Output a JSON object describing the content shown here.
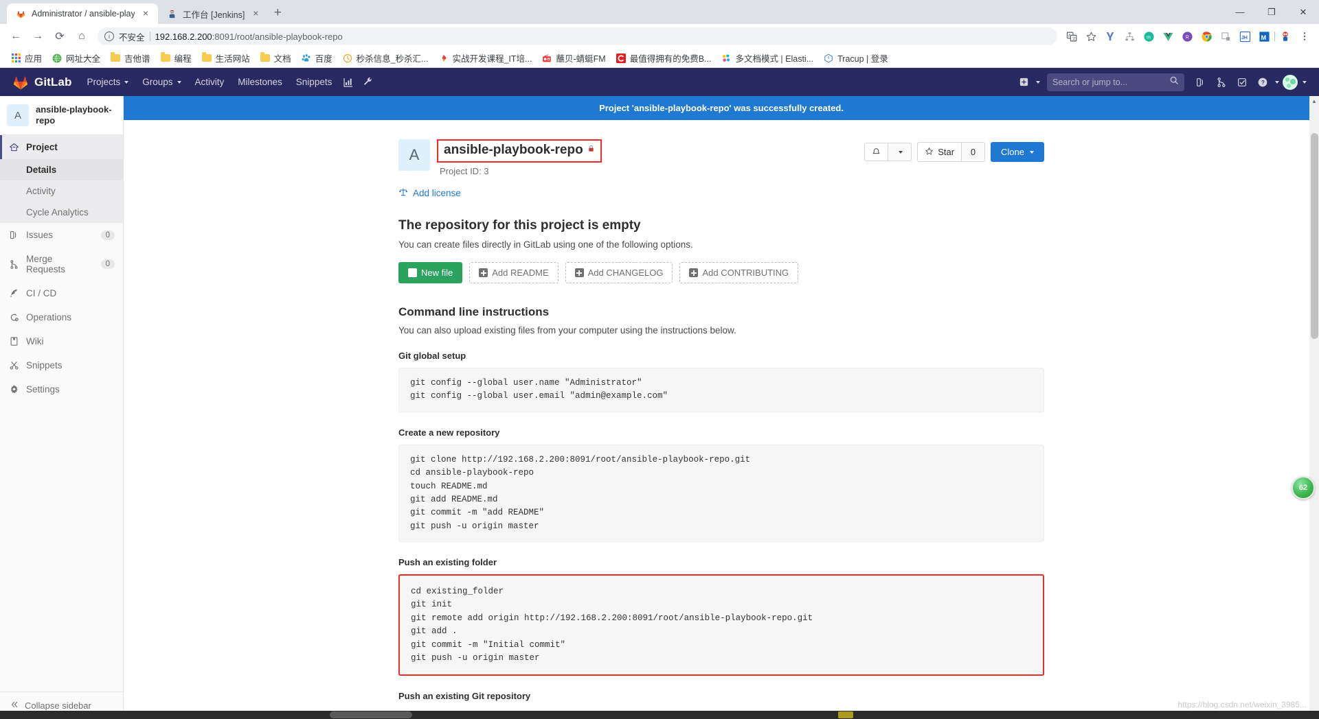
{
  "browser": {
    "tabs": [
      {
        "title": "Administrator / ansible-playbo",
        "favicon": "gitlab-fox-icon",
        "active": true,
        "close": "×"
      },
      {
        "title": "工作台 [Jenkins]",
        "favicon": "jenkins-icon",
        "active": false,
        "close": "×"
      }
    ],
    "new_tab_label": "+",
    "window_controls": {
      "minimize": "—",
      "maximize": "❐",
      "close": "✕"
    },
    "nav": {
      "back": "←",
      "forward": "→",
      "reload": "⟳",
      "home": "⌂",
      "security_label": "不安全",
      "url": "192.168.2.200:8091/root/ansible-playbook-repo",
      "url_host": "192.168.2.200",
      "url_path": ":8091/root/ansible-playbook-repo"
    },
    "toolbar_icons": [
      "translate-icon",
      "bookmark-star-icon",
      "yandex-icon",
      "sitemap-icon",
      "mind-icon",
      "vue-devtools-icon",
      "redux-icon",
      "chrome-color-icon",
      "screenshot-icon",
      "jh-icon",
      "m-icon",
      "spiderman-avatar-icon",
      "more-menu-icon"
    ],
    "bookmarks": [
      {
        "label": "应用",
        "icon": "apps-grid-icon"
      },
      {
        "label": "网址大全",
        "icon": "green-globe-icon"
      },
      {
        "label": "吉他谱",
        "icon": "folder-icon"
      },
      {
        "label": "编程",
        "icon": "folder-icon"
      },
      {
        "label": "生活网站",
        "icon": "folder-icon"
      },
      {
        "label": "文档",
        "icon": "folder-icon"
      },
      {
        "label": "百度",
        "icon": "baidu-icon"
      },
      {
        "label": "秒杀信息_秒杀汇...",
        "icon": "clock-icon"
      },
      {
        "label": "实战开发课程_IT培...",
        "icon": "flame-icon"
      },
      {
        "label": "蘸贝-蜻蜓FM",
        "icon": "radio-icon"
      },
      {
        "label": "最值得拥有的免费B...",
        "icon": "c-red-icon"
      },
      {
        "label": "多文档模式 | Elasti...",
        "icon": "elastic-icon"
      },
      {
        "label": "Tracup | 登录",
        "icon": "tracup-icon"
      }
    ]
  },
  "gitlab": {
    "brand": "GitLab",
    "nav_items": [
      {
        "label": "Projects",
        "has_caret": true
      },
      {
        "label": "Groups",
        "has_caret": true
      },
      {
        "label": "Activity",
        "has_caret": false
      },
      {
        "label": "Milestones",
        "has_caret": false
      },
      {
        "label": "Snippets",
        "has_caret": false
      }
    ],
    "nav_icons_left": [
      "chart-icon",
      "wrench-icon"
    ],
    "search_placeholder": "Search or jump to...",
    "nav_icons_right": [
      "plus-box-icon",
      "issues-icon",
      "merge-requests-icon",
      "todos-icon",
      "help-icon",
      "user-avatar"
    ],
    "sidebar": {
      "project_initial": "A",
      "project_name": "ansible-playbook-repo",
      "items": [
        {
          "label": "Project",
          "icon": "home-icon",
          "active": true,
          "badge": ""
        },
        {
          "label": "Issues",
          "icon": "issues-icon",
          "active": false,
          "badge": "0"
        },
        {
          "label": "Merge Requests",
          "icon": "merge-icon",
          "active": false,
          "badge": "0"
        },
        {
          "label": "CI / CD",
          "icon": "rocket-icon",
          "active": false,
          "badge": ""
        },
        {
          "label": "Operations",
          "icon": "operations-icon",
          "active": false,
          "badge": ""
        },
        {
          "label": "Wiki",
          "icon": "book-icon",
          "active": false,
          "badge": ""
        },
        {
          "label": "Snippets",
          "icon": "scissors-icon",
          "active": false,
          "badge": ""
        },
        {
          "label": "Settings",
          "icon": "gear-icon",
          "active": false,
          "badge": ""
        }
      ],
      "sub_items": [
        {
          "label": "Details",
          "current": true
        },
        {
          "label": "Activity",
          "current": false
        },
        {
          "label": "Cycle Analytics",
          "current": false
        }
      ],
      "collapse_label": "Collapse sidebar",
      "collapse_icon": "chevron-double-left-icon"
    },
    "flash_message": "Project 'ansible-playbook-repo' was successfully created.",
    "project": {
      "initial": "A",
      "name": "ansible-playbook-repo",
      "visibility_icon": "lock-icon",
      "id_label": "Project ID: 3",
      "notification_icon": "bell-icon",
      "star_label": "Star",
      "star_icon": "star-icon",
      "star_count": "0",
      "clone_label": "Clone",
      "add_license_label": "Add license",
      "add_license_icon": "scales-icon"
    },
    "empty_repo": {
      "heading": "The repository for this project is empty",
      "subtext": "You can create files directly in GitLab using one of the following options.",
      "buttons": [
        {
          "label": "New file",
          "style": "success"
        },
        {
          "label": "Add README",
          "style": "dashed"
        },
        {
          "label": "Add CHANGELOG",
          "style": "dashed"
        },
        {
          "label": "Add CONTRIBUTING",
          "style": "dashed"
        }
      ]
    },
    "cli": {
      "heading": "Command line instructions",
      "subtext": "You can also upload existing files from your computer using the instructions below.",
      "sections": [
        {
          "title": "Git global setup",
          "code": "git config --global user.name \"Administrator\"\ngit config --global user.email \"admin@example.com\"",
          "highlight": false
        },
        {
          "title": "Create a new repository",
          "code": "git clone http://192.168.2.200:8091/root/ansible-playbook-repo.git\ncd ansible-playbook-repo\ntouch README.md\ngit add README.md\ngit commit -m \"add README\"\ngit push -u origin master",
          "highlight": false
        },
        {
          "title": "Push an existing folder",
          "code": "cd existing_folder\ngit init\ngit remote add origin http://192.168.2.200:8091/root/ansible-playbook-repo.git\ngit add .\ngit commit -m \"Initial commit\"\ngit push -u origin master",
          "highlight": true
        },
        {
          "title": "Push an existing Git repository",
          "code": "",
          "highlight": false
        }
      ]
    }
  },
  "overlays": {
    "float_badge": "62",
    "watermark": "https://blog.csdn.net/weixin_3985..."
  },
  "colors": {
    "gitlab_nav": "#292961",
    "flash_blue": "#1f78d1",
    "primary": "#1f78d1",
    "success": "#2ca25f",
    "highlight_red": "#ef2b2b",
    "sidebar_bg": "#fafafa"
  }
}
